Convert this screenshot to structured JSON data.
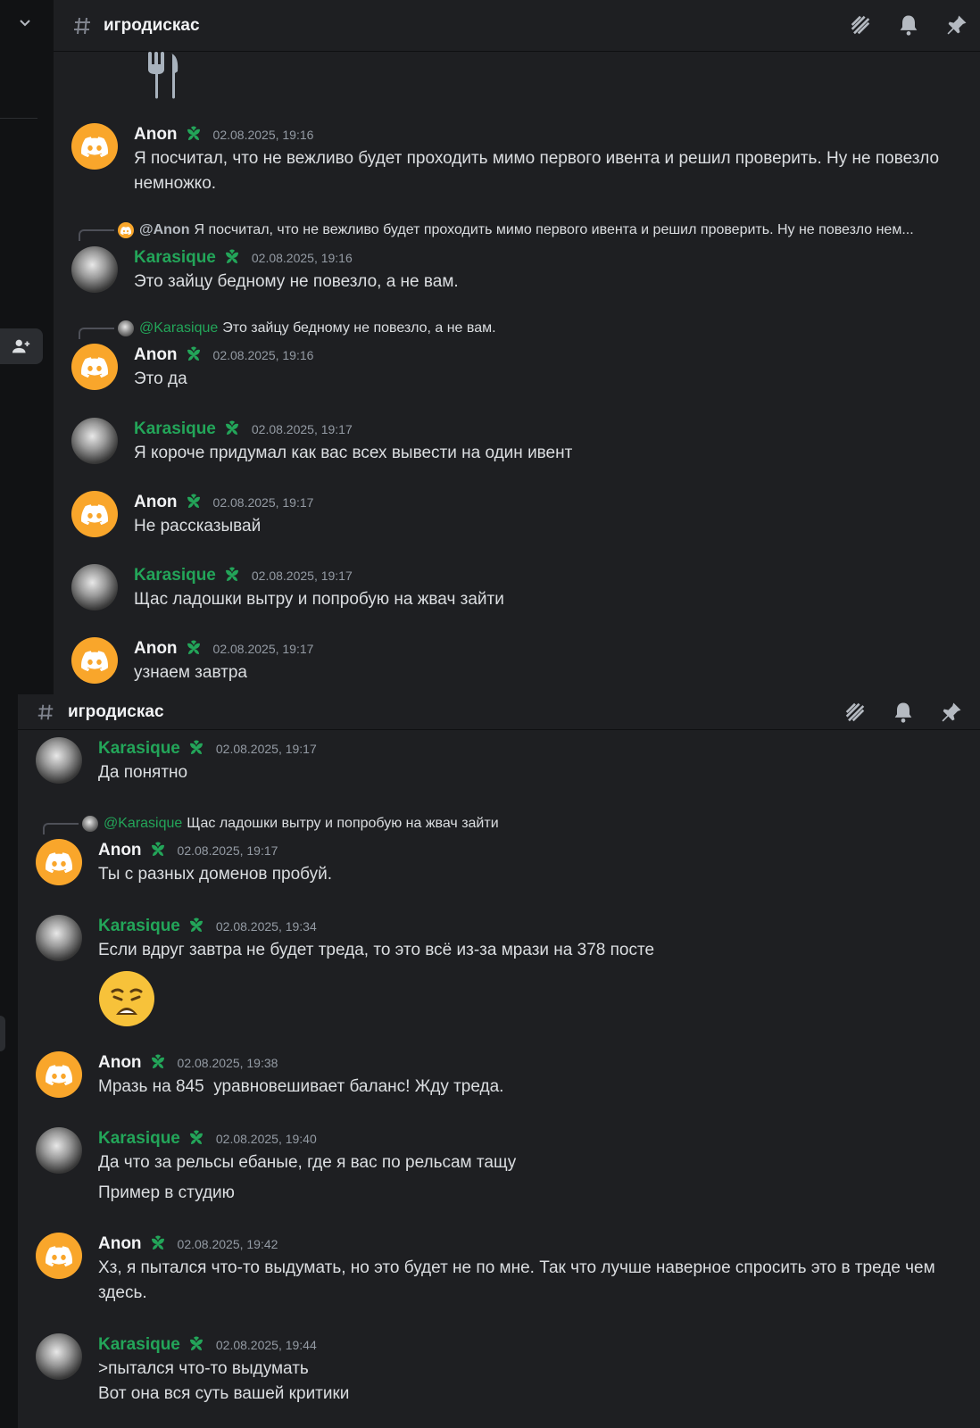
{
  "channel": {
    "name": "игродискас"
  },
  "icons": {
    "header": [
      "threads-icon",
      "bell-icon",
      "pin-icon"
    ],
    "sidebar": [
      "chevron-down-icon",
      "add-friend-icon"
    ],
    "top_emoji": "fork-knife-icon",
    "big_emoji": "weary-face-emoji"
  },
  "colors": {
    "background": "#1e1f22",
    "anon_avatar": "#f9a62b",
    "karasique_name": "#23a559",
    "text": "#dbdee1",
    "timestamp": "#949ba4"
  },
  "top_messages": [
    {
      "author": "Anon",
      "time": "02.08.2025, 19:16",
      "text": "Я посчитал, что не вежливо будет проходить мимо первого ивента и решил проверить. Ну не повезло немножко."
    },
    {
      "reply_to": {
        "author": "@Anon",
        "text": "Я посчитал, что не вежливо будет проходить мимо первого ивента и решил проверить. Ну не повезло нем..."
      },
      "author": "Karasique",
      "time": "02.08.2025, 19:16",
      "text": "Это зайцу бедному не повезло, а не вам."
    },
    {
      "reply_to": {
        "author": "@Karasique",
        "text": "Это зайцу бедному не повезло, а не вам."
      },
      "author": "Anon",
      "time": "02.08.2025, 19:16",
      "text": "Это да"
    },
    {
      "author": "Karasique",
      "time": "02.08.2025, 19:17",
      "text": "Я короче придумал как вас всех вывести на один ивент"
    },
    {
      "author": "Anon",
      "time": "02.08.2025, 19:17",
      "text": "Не рассказывай"
    },
    {
      "author": "Karasique",
      "time": "02.08.2025, 19:17",
      "text": "Щас ладошки вытру и попробую на жвач зайти"
    },
    {
      "author": "Anon",
      "time": "02.08.2025, 19:17",
      "text": "узнаем завтра"
    }
  ],
  "bottom_messages": [
    {
      "author": "Karasique",
      "time": "02.08.2025, 19:17",
      "text": "Да понятно"
    },
    {
      "reply_to": {
        "author": "@Karasique",
        "text": "Щас ладошки вытру и попробую на жвач зайти"
      },
      "author": "Anon",
      "time": "02.08.2025, 19:17",
      "text": "Ты с разных доменов пробуй."
    },
    {
      "author": "Karasique",
      "time": "02.08.2025, 19:34",
      "text": "Если вдруг завтра не будет треда, то это всё из-за мрази на 378 посте"
    },
    {
      "author": "Anon",
      "time": "02.08.2025, 19:38",
      "text": "Мразь на 845  уравновешивает баланс! Жду треда."
    },
    {
      "author": "Karasique",
      "time": "02.08.2025, 19:40",
      "text": "Да что за рельсы ебаные, где я вас по рельсам тащу",
      "text2": "Пример в студию"
    },
    {
      "author": "Anon",
      "time": "02.08.2025, 19:42",
      "text": "Хз, я пытался что-то выдумать, но это будет не по мне. Так что лучше наверное спросить это в треде чем здесь."
    },
    {
      "author": "Karasique",
      "time": "02.08.2025, 19:44",
      "text": ">пытался что-то выдумать",
      "text2": "Вот она вся суть вашей критики"
    }
  ]
}
